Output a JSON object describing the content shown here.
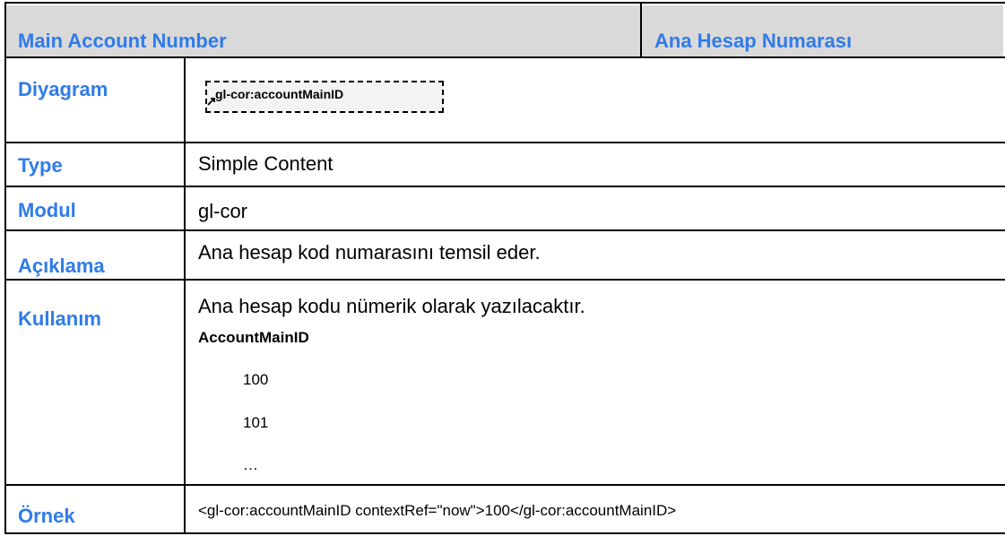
{
  "header": {
    "left": "Main Account Number",
    "right": "Ana Hesap Numarası"
  },
  "rows": {
    "diyagram": {
      "label": "Diyagram",
      "element": "gl-cor:accountMainID"
    },
    "type": {
      "label": "Type",
      "value": "Simple Content"
    },
    "modul": {
      "label": "Modul",
      "value": "gl-cor"
    },
    "aciklama": {
      "label": "Açıklama",
      "value": "Ana hesap kod numarasını temsil eder."
    },
    "kullanim": {
      "label": "Kullanım",
      "value": "Ana hesap kodu nümerik olarak yazılacaktır.",
      "field": "AccountMainID",
      "examples": [
        "100",
        "101",
        "…"
      ]
    },
    "ornek": {
      "label": "Örnek",
      "value": "<gl-cor:accountMainID contextRef=\"now\">100</gl-cor:accountMainID>"
    }
  },
  "colors": {
    "label": "#2f7bea",
    "header_bg": "#d9d9d9"
  }
}
